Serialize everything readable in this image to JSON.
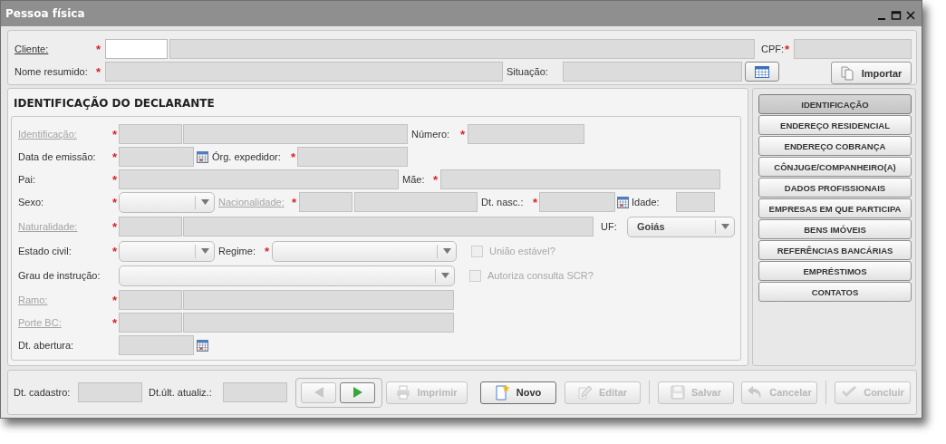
{
  "window": {
    "title": "Pessoa física"
  },
  "header": {
    "rows": [
      {
        "items": [
          {
            "kind": "label",
            "text": "Cliente:",
            "link": true,
            "disabled": false
          },
          {
            "kind": "required",
            "text": "*"
          },
          {
            "kind": "input",
            "disabled": false
          },
          {
            "kind": "input",
            "disabled": true
          },
          {
            "kind": "label",
            "text": "CPF:",
            "link": false,
            "disabled": false
          },
          {
            "kind": "required",
            "text": "*"
          },
          {
            "kind": "input",
            "disabled": true
          }
        ]
      },
      {
        "items": [
          {
            "kind": "label",
            "text": "Nome resumido:",
            "link": false,
            "disabled": false
          },
          {
            "kind": "required",
            "text": "*"
          },
          {
            "kind": "input",
            "disabled": true
          },
          {
            "kind": "label",
            "text": "Situação:",
            "link": false,
            "disabled": false
          },
          {
            "kind": "input",
            "disabled": true
          },
          {
            "kind": "icon_button",
            "disabled": false
          },
          {
            "kind": "button",
            "text": "Importar",
            "disabled": false
          }
        ]
      }
    ]
  },
  "section": {
    "title": "IDENTIFICAÇÃO DO DECLARANTE",
    "rows": [
      {
        "items": [
          {
            "kind": "label",
            "text": "Identificação:",
            "link": true,
            "disabled": true
          },
          {
            "kind": "required",
            "text": "*"
          },
          {
            "kind": "input",
            "disabled": true
          },
          {
            "kind": "input",
            "disabled": true
          },
          {
            "kind": "label",
            "text": "Número:",
            "link": false,
            "disabled": false
          },
          {
            "kind": "required",
            "text": "*"
          },
          {
            "kind": "input",
            "disabled": true
          }
        ]
      },
      {
        "items": [
          {
            "kind": "label",
            "text": "Data de emissão:",
            "link": false,
            "disabled": false
          },
          {
            "kind": "required",
            "text": "*"
          },
          {
            "kind": "input",
            "disabled": true
          },
          {
            "kind": "calendar"
          },
          {
            "kind": "label",
            "text": "Órg. expedidor:",
            "link": false,
            "disabled": false
          },
          {
            "kind": "required",
            "text": "*"
          },
          {
            "kind": "input",
            "disabled": true
          }
        ]
      },
      {
        "items": [
          {
            "kind": "label",
            "text": "Pai:",
            "link": false,
            "disabled": false
          },
          {
            "kind": "required",
            "text": "*"
          },
          {
            "kind": "input",
            "disabled": true
          },
          {
            "kind": "label",
            "text": "Mãe:",
            "link": false,
            "disabled": false
          },
          {
            "kind": "required",
            "text": "*"
          },
          {
            "kind": "input",
            "disabled": true
          }
        ]
      },
      {
        "items": [
          {
            "kind": "label",
            "text": "Sexo:",
            "link": false,
            "disabled": false
          },
          {
            "kind": "required",
            "text": "*"
          },
          {
            "kind": "combo",
            "disabled": false
          },
          {
            "kind": "label",
            "text": "Nacionalidade:",
            "link": true,
            "disabled": true
          },
          {
            "kind": "required",
            "text": "*"
          },
          {
            "kind": "input",
            "disabled": true
          },
          {
            "kind": "input",
            "disabled": true
          },
          {
            "kind": "label",
            "text": "Dt. nasc.:",
            "link": false,
            "disabled": false
          },
          {
            "kind": "required",
            "text": "*"
          },
          {
            "kind": "input",
            "disabled": true
          },
          {
            "kind": "calendar"
          },
          {
            "kind": "label",
            "text": "Idade:",
            "link": false,
            "disabled": false
          },
          {
            "kind": "input",
            "disabled": true
          }
        ]
      },
      {
        "items": [
          {
            "kind": "label",
            "text": "Naturalidade:",
            "link": true,
            "disabled": true
          },
          {
            "kind": "required",
            "text": "*"
          },
          {
            "kind": "input",
            "disabled": true
          },
          {
            "kind": "input",
            "disabled": true
          },
          {
            "kind": "label",
            "text": "UF:",
            "link": false,
            "disabled": false
          },
          {
            "kind": "combo",
            "disabled": false,
            "value": "Goiás"
          }
        ]
      },
      {
        "items": [
          {
            "kind": "label",
            "text": "Estado civil:",
            "link": false,
            "disabled": false
          },
          {
            "kind": "required",
            "text": "*"
          },
          {
            "kind": "combo",
            "disabled": false
          },
          {
            "kind": "label",
            "text": "Regime:",
            "link": false,
            "disabled": false
          },
          {
            "kind": "required",
            "text": "*"
          },
          {
            "kind": "combo",
            "disabled": false
          },
          {
            "kind": "checkbox",
            "text": "União estável?",
            "checked": false,
            "disabled": true
          }
        ]
      },
      {
        "items": [
          {
            "kind": "label",
            "text": "Grau de instrução:",
            "link": false,
            "disabled": false
          },
          {
            "kind": "combo",
            "disabled": false
          },
          {
            "kind": "checkbox",
            "text": "Autoriza consulta SCR?",
            "checked": false,
            "disabled": true
          }
        ]
      },
      {
        "items": [
          {
            "kind": "label",
            "text": "Ramo:",
            "link": true,
            "disabled": true
          },
          {
            "kind": "required",
            "text": "*"
          },
          {
            "kind": "input",
            "disabled": true
          },
          {
            "kind": "input",
            "disabled": true
          }
        ]
      },
      {
        "items": [
          {
            "kind": "label",
            "text": "Porte BC:",
            "link": true,
            "disabled": true
          },
          {
            "kind": "required",
            "text": "*"
          },
          {
            "kind": "input",
            "disabled": true
          },
          {
            "kind": "input",
            "disabled": true
          }
        ]
      },
      {
        "items": [
          {
            "kind": "label",
            "text": "Dt. abertura:",
            "link": false,
            "disabled": false
          },
          {
            "kind": "input",
            "disabled": true
          },
          {
            "kind": "calendar"
          }
        ]
      }
    ]
  },
  "sidebar": {
    "items": [
      {
        "label": "IDENTIFICAÇÃO",
        "selected": true
      },
      {
        "label": "ENDEREÇO RESIDENCIAL",
        "selected": false
      },
      {
        "label": "ENDEREÇO COBRANÇA",
        "selected": false
      },
      {
        "label": "CÔNJUGE/COMPANHEIRO(A)",
        "selected": false
      },
      {
        "label": "DADOS PROFISSIONAIS",
        "selected": false
      },
      {
        "label": "EMPRESAS EM QUE PARTICIPA",
        "selected": false
      },
      {
        "label": "BENS IMÓVEIS",
        "selected": false
      },
      {
        "label": "REFERÊNCIAS BANCÁRIAS",
        "selected": false
      },
      {
        "label": "EMPRÉSTIMOS",
        "selected": false
      },
      {
        "label": "CONTATOS",
        "selected": false
      }
    ]
  },
  "footer": {
    "fields": [
      {
        "label": "Dt. cadastro:",
        "disabled": true
      },
      {
        "label": "Dt.últ. atualiz.:",
        "disabled": true
      }
    ],
    "navigation": [
      {
        "disabled": true
      },
      {
        "disabled": false
      }
    ],
    "actions": [
      {
        "label": "Imprimir",
        "disabled": true
      },
      {
        "label": "Novo",
        "disabled": false
      },
      {
        "label": "Editar",
        "disabled": true
      },
      {
        "label": "Salvar",
        "disabled": true
      },
      {
        "label": "Cancelar",
        "disabled": true
      },
      {
        "label": "Concluir",
        "disabled": true
      }
    ]
  }
}
